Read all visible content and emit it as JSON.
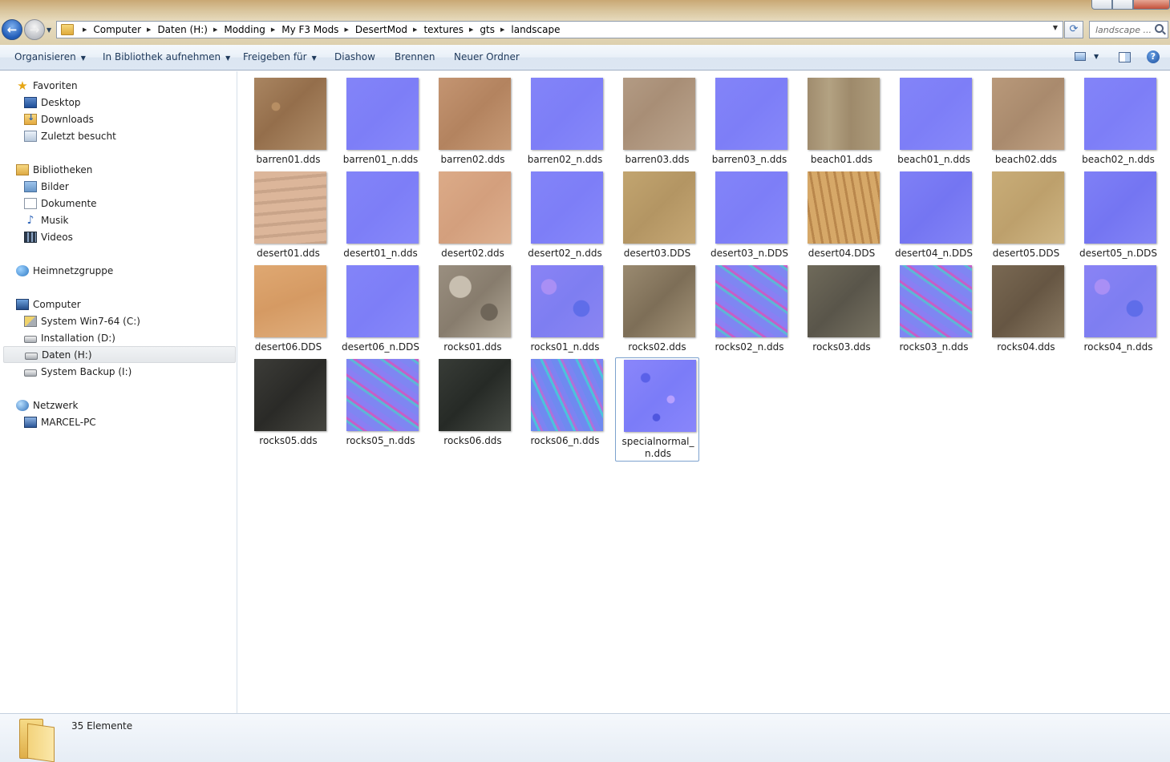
{
  "window": {
    "breadcrumb": [
      "Computer",
      "Daten (H:)",
      "Modding",
      "My F3 Mods",
      "DesertMod",
      "textures",
      "gts",
      "landscape"
    ],
    "search_placeholder": "landscape ..."
  },
  "toolbar": {
    "organize": "Organisieren",
    "include_library": "In Bibliothek aufnehmen",
    "share_with": "Freigeben für",
    "slideshow": "Diashow",
    "burn": "Brennen",
    "new_folder": "Neuer Ordner"
  },
  "sidebar": {
    "favorites": {
      "label": "Favoriten",
      "items": [
        "Desktop",
        "Downloads",
        "Zuletzt besucht"
      ]
    },
    "libraries": {
      "label": "Bibliotheken",
      "items": [
        "Bilder",
        "Dokumente",
        "Musik",
        "Videos"
      ]
    },
    "homegroup": {
      "label": "Heimnetzgruppe"
    },
    "computer": {
      "label": "Computer",
      "items": [
        "System Win7-64 (C:)",
        "Installation (D:)",
        "Daten (H:)",
        "System Backup (I:)"
      ]
    },
    "network": {
      "label": "Netzwerk",
      "items": [
        "MARCEL-PC"
      ]
    }
  },
  "files": [
    {
      "name": "barren01.dds",
      "texture": "barren1"
    },
    {
      "name": "barren01_n.dds",
      "texture": "nflat"
    },
    {
      "name": "barren02.dds",
      "texture": "barren2"
    },
    {
      "name": "barren02_n.dds",
      "texture": "nflat"
    },
    {
      "name": "barren03.dds",
      "texture": "barren3"
    },
    {
      "name": "barren03_n.dds",
      "texture": "nflat"
    },
    {
      "name": "beach01.dds",
      "texture": "beach1"
    },
    {
      "name": "beach01_n.dds",
      "texture": "nflat"
    },
    {
      "name": "beach02.dds",
      "texture": "beach2"
    },
    {
      "name": "beach02_n.dds",
      "texture": "nflat"
    },
    {
      "name": "desert01.dds",
      "texture": "desert1"
    },
    {
      "name": "desert01_n.dds",
      "texture": "nflat"
    },
    {
      "name": "desert02.dds",
      "texture": "desert2"
    },
    {
      "name": "desert02_n.dds",
      "texture": "nflat"
    },
    {
      "name": "desert03.DDS",
      "texture": "desert3"
    },
    {
      "name": "desert03_n.DDS",
      "texture": "nflat"
    },
    {
      "name": "desert04.DDS",
      "texture": "desert4"
    },
    {
      "name": "desert04_n.DDS",
      "texture": "nlight"
    },
    {
      "name": "desert05.DDS",
      "texture": "desert5"
    },
    {
      "name": "desert05_n.DDS",
      "texture": "nlight"
    },
    {
      "name": "desert06.DDS",
      "texture": "desert6"
    },
    {
      "name": "desert06_n.DDS",
      "texture": "nflat"
    },
    {
      "name": "rocks01.dds",
      "texture": "rocks1"
    },
    {
      "name": "rocks01_n.dds",
      "texture": "nbump"
    },
    {
      "name": "rocks02.dds",
      "texture": "rocks2"
    },
    {
      "name": "rocks02_n.dds",
      "texture": "nstripe"
    },
    {
      "name": "rocks03.dds",
      "texture": "rocks3"
    },
    {
      "name": "rocks03_n.dds",
      "texture": "nstripe"
    },
    {
      "name": "rocks04.dds",
      "texture": "rocks4"
    },
    {
      "name": "rocks04_n.dds",
      "texture": "nbump"
    },
    {
      "name": "rocks05.dds",
      "texture": "rocks5"
    },
    {
      "name": "rocks05_n.dds",
      "texture": "nstripe"
    },
    {
      "name": "rocks06.dds",
      "texture": "rocks6"
    },
    {
      "name": "rocks06_n.dds",
      "texture": "nrock6"
    },
    {
      "name": "specialnormal_n.dds",
      "texture": "special",
      "selected": true
    }
  ],
  "status": {
    "count": "35 Elemente"
  }
}
